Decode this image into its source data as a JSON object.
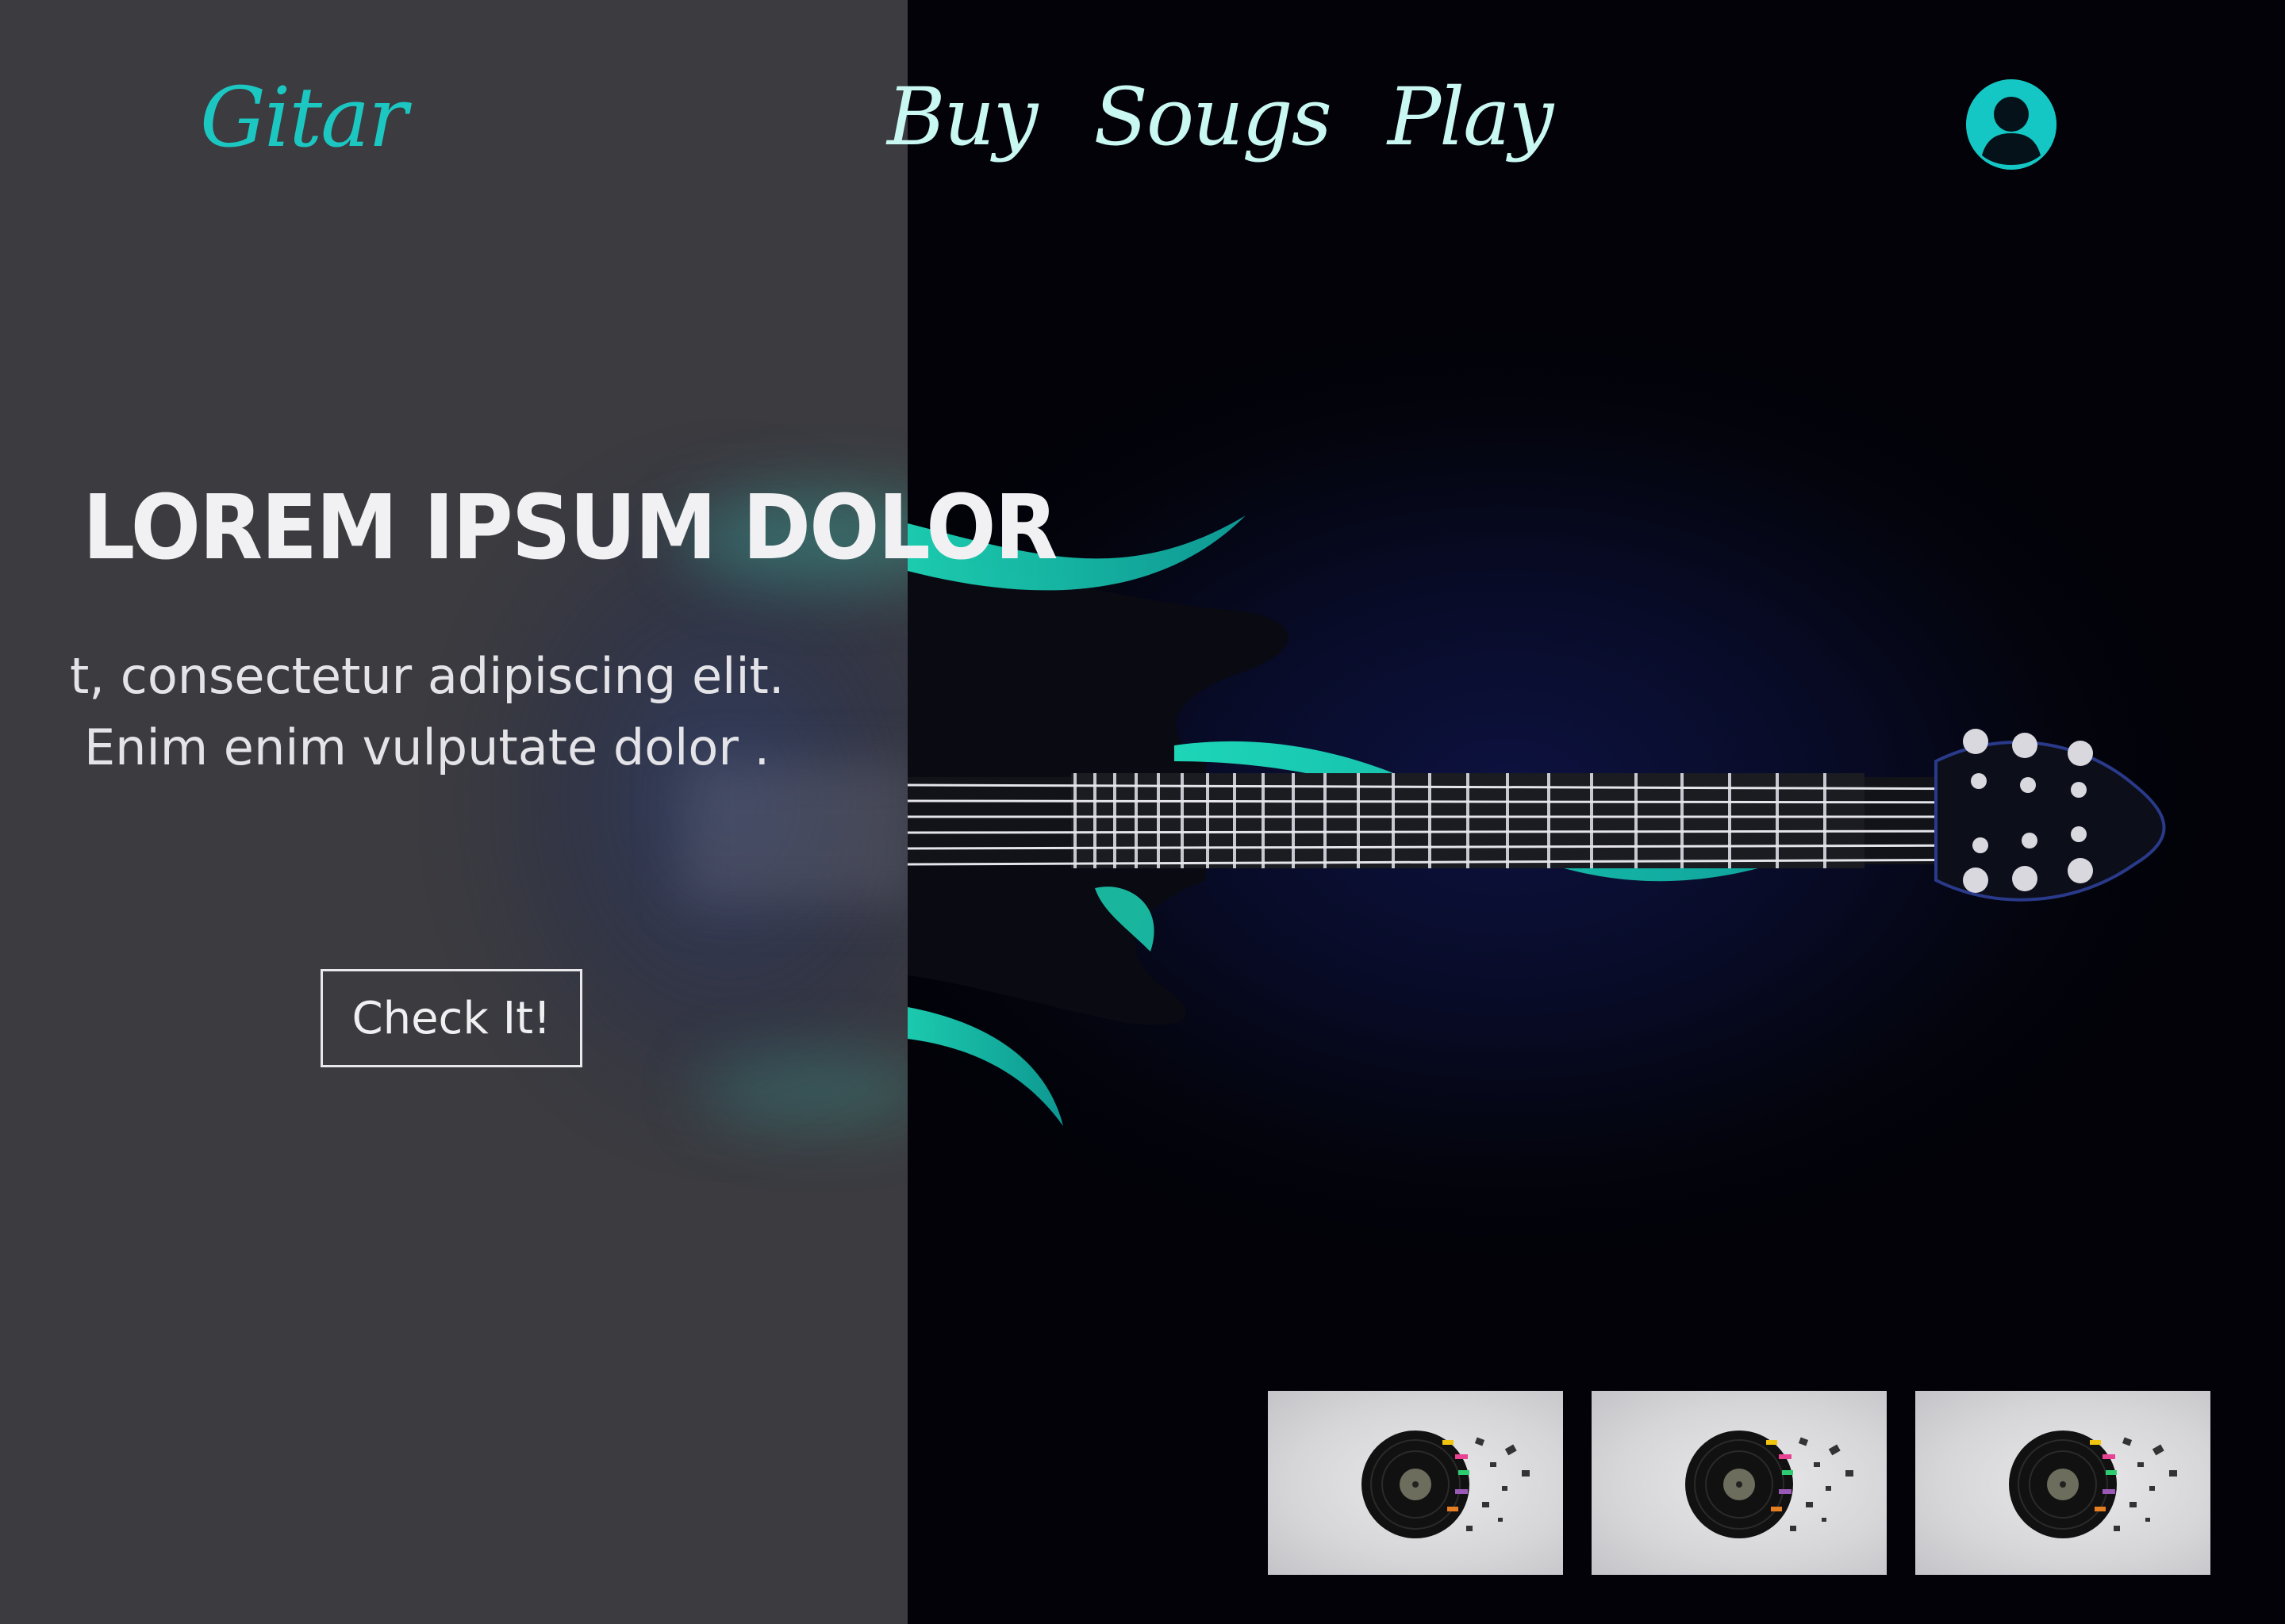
{
  "brand": {
    "logo_text": "Gitar",
    "accent": "#1cc7c2",
    "nav_color": "#c9f7f2",
    "panel_color": "#3b3b40"
  },
  "nav": {
    "items": [
      {
        "label": "Buy"
      },
      {
        "label": "Sougs"
      },
      {
        "label": "Play"
      }
    ],
    "account_icon": "user-avatar-icon"
  },
  "hero": {
    "title": "LOREM IPSUM DOLOR",
    "subtitle_line1": "t, consectetur adipiscing elit.",
    "subtitle_line2": "Enim enim vulputate dolor .",
    "cta_label": "Check It!",
    "background_image": "electric-guitar-neon-art"
  },
  "thumbnails": [
    {
      "image": "shattered-vinyl-record"
    },
    {
      "image": "shattered-vinyl-record"
    },
    {
      "image": "shattered-vinyl-record"
    }
  ]
}
